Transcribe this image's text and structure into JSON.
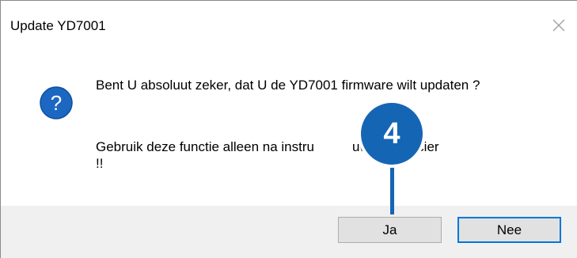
{
  "window": {
    "title": "Update YD7001",
    "close_glyph": "✕"
  },
  "message": {
    "line1": "Bent U absoluut zeker, dat U de YD7001 firmware wilt updaten ?",
    "line2": "Gebruik deze functie alleen na instru",
    "line2_tail": "uw leverancier",
    "line2_end": "!!"
  },
  "icon": {
    "name": "question-icon",
    "glyph": "?",
    "color": "#1c67c2"
  },
  "buttons": {
    "yes_label": "Ja",
    "no_label": "Nee"
  },
  "callout": {
    "number": "4",
    "color": "#1565b5"
  }
}
